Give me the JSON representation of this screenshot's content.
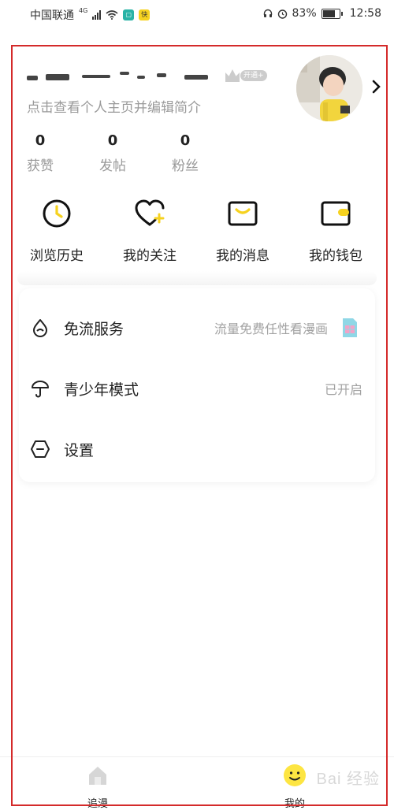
{
  "status_bar": {
    "carrier": "中国联通",
    "network": "4G",
    "battery": "83%",
    "time": "12:58"
  },
  "profile": {
    "subtitle": "点击查看个人主页并编辑简介",
    "vip_badge": "开通+",
    "stats": [
      {
        "count": "0",
        "label": "获赞"
      },
      {
        "count": "0",
        "label": "发帖"
      },
      {
        "count": "0",
        "label": "粉丝"
      }
    ]
  },
  "quick_actions": [
    {
      "label": "浏览历史",
      "icon": "clock-icon"
    },
    {
      "label": "我的关注",
      "icon": "heart-plus-icon"
    },
    {
      "label": "我的消息",
      "icon": "message-icon"
    },
    {
      "label": "我的钱包",
      "icon": "wallet-icon"
    }
  ],
  "menu": [
    {
      "label": "免流服务",
      "detail": "流量免费任性看漫画",
      "icon": "water-drop-icon"
    },
    {
      "label": "青少年模式",
      "detail": "已开启",
      "icon": "umbrella-icon"
    },
    {
      "label": "设置",
      "detail": "",
      "icon": "settings-hexagon-icon"
    }
  ],
  "tabs": [
    {
      "label": "追漫",
      "icon": "home-icon"
    },
    {
      "label": "我的",
      "icon": "smile-face-icon"
    }
  ],
  "watermark": "Bai 经验",
  "colors": {
    "accent_yellow": "#fde542",
    "highlight_red": "#d42a2a"
  }
}
